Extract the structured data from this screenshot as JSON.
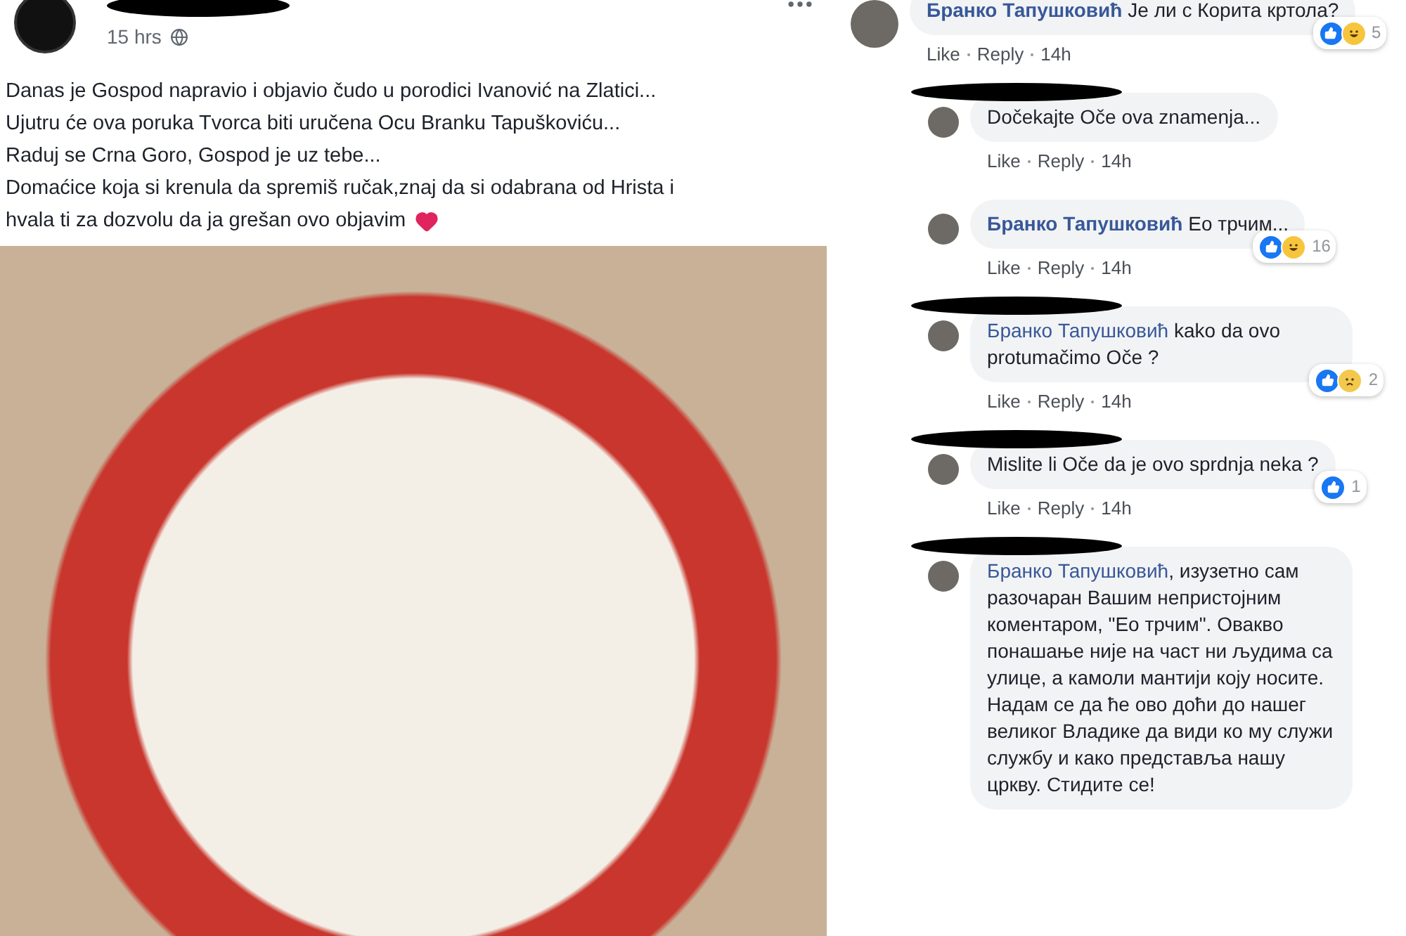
{
  "post": {
    "author_redacted": true,
    "time": "15 hrs",
    "lines": [
      "Danas je Gospod napravio i objavio čudo u porodici Ivanović na Zlatici...",
      "Ujutru će ova poruka Tvorca biti uručena Ocu Branku Tapuškoviću...",
      "Raduj se Crna Goro, Gospod je uz tebe...",
      "Domaćice koja si krenula da spremiš ručak,znaj da si odabrana od Hrista i",
      "hvala ti za dozvolu da ja grešan ovo objavim"
    ]
  },
  "comments": [
    {
      "reply": false,
      "redacted": false,
      "author": "Бранко Тапушковић",
      "text": "Је ли с Корита кртола?",
      "reactions": [
        {
          "kind": "like"
        },
        {
          "kind": "haha"
        }
      ],
      "count": "5",
      "actions": [
        "Like",
        "Reply"
      ],
      "time": "14h"
    },
    {
      "reply": true,
      "redacted": true,
      "text": "Dočekajte Oče ova znamenja...",
      "actions": [
        "Like",
        "Reply"
      ],
      "time": "14h"
    },
    {
      "reply": true,
      "redacted": false,
      "author": "Бранко Тапушковић",
      "text": "Ео трчим...",
      "reactions": [
        {
          "kind": "like"
        },
        {
          "kind": "haha"
        }
      ],
      "count": "16",
      "actions": [
        "Like",
        "Reply"
      ],
      "time": "14h"
    },
    {
      "reply": true,
      "redacted": true,
      "mention": "Бранко Тапушковић",
      "text": "kako da ovo protumačimo Oče ?",
      "reactions": [
        {
          "kind": "like"
        },
        {
          "kind": "sad"
        }
      ],
      "count": "2",
      "actions": [
        "Like",
        "Reply"
      ],
      "time": "14h"
    },
    {
      "reply": true,
      "redacted": true,
      "text": "Mislite li Oče da je ovo sprdnja neka ?",
      "reactions": [
        {
          "kind": "like"
        }
      ],
      "count": "1",
      "actions": [
        "Like",
        "Reply"
      ],
      "time": "14h"
    },
    {
      "reply": true,
      "redacted": true,
      "mention": "Бранко Тапушковић",
      "text": ", изузетно сам разочаран Вашим непристојним коментаром, \"Ео трчим\". Овакво понашање није на част ни људима са улице, а камоли мантији коју носите. Надам се да ће ово доћи до нашег великог Владике да види ко му служи службу и како представља нашу цркву. Стидите се!"
    }
  ]
}
